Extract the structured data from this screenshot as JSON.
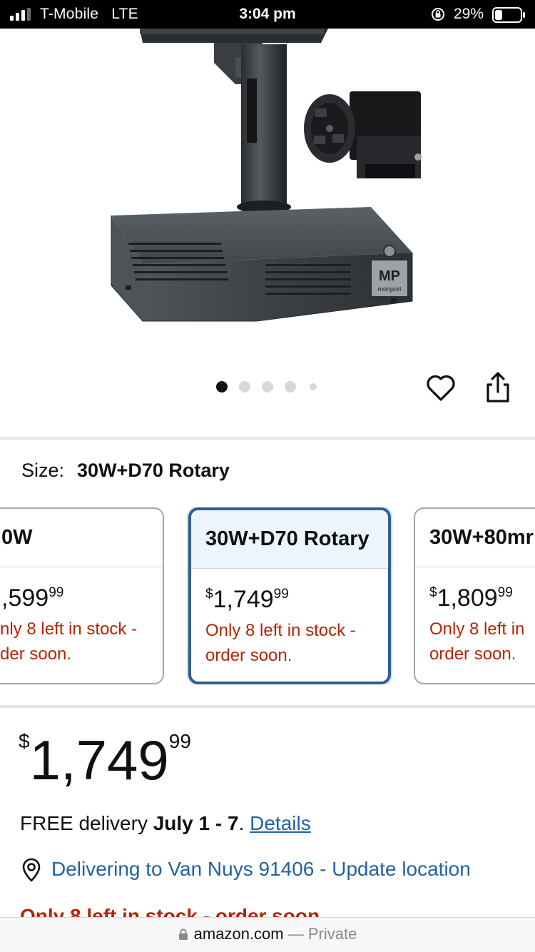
{
  "status_bar": {
    "carrier": "T-Mobile   LTE",
    "time": "3:04 pm",
    "battery_percent": "29%",
    "battery_level": 0.29
  },
  "product_image": {
    "brand_mark": "MP",
    "brand_name": "monport"
  },
  "carousel": {
    "total_images": 5,
    "active_index": 0
  },
  "actions": {
    "favorite_icon": "heart-icon",
    "share_icon": "share-icon"
  },
  "size": {
    "label": "Size:",
    "value": "30W+D70 Rotary"
  },
  "swatches": [
    {
      "title": "0W",
      "currency": "$",
      "whole": ",599",
      "cents": "99",
      "stock_line1": "nly 8 left in stock -",
      "stock_line2": "der soon."
    },
    {
      "title": "30W+D70 Rotary",
      "currency": "$",
      "whole": "1,749",
      "cents": "99",
      "stock_line1": "Only 8 left in stock -",
      "stock_line2": "order soon."
    },
    {
      "title": "30W+80mr",
      "currency": "$",
      "whole": "1,809",
      "cents": "99",
      "stock_line1": "Only 8 left in",
      "stock_line2": "order soon."
    }
  ],
  "price": {
    "currency": "$",
    "whole": "1,749",
    "cents": "99"
  },
  "delivery": {
    "prefix": "FREE delivery ",
    "dates": "July 1 - 7",
    "suffix": ". ",
    "details_link": "Details"
  },
  "location": {
    "text": "Delivering to Van Nuys 91406 - Update location"
  },
  "stock_peek": "Only 8 left in stock - order soon.",
  "url_bar": {
    "domain": "amazon.com",
    "separator": " — ",
    "mode": "Private"
  },
  "colors": {
    "link": "#2162a1",
    "stock_warning": "#b12704",
    "selected_border": "#2f5e94",
    "selected_header": "#edf5fc"
  }
}
